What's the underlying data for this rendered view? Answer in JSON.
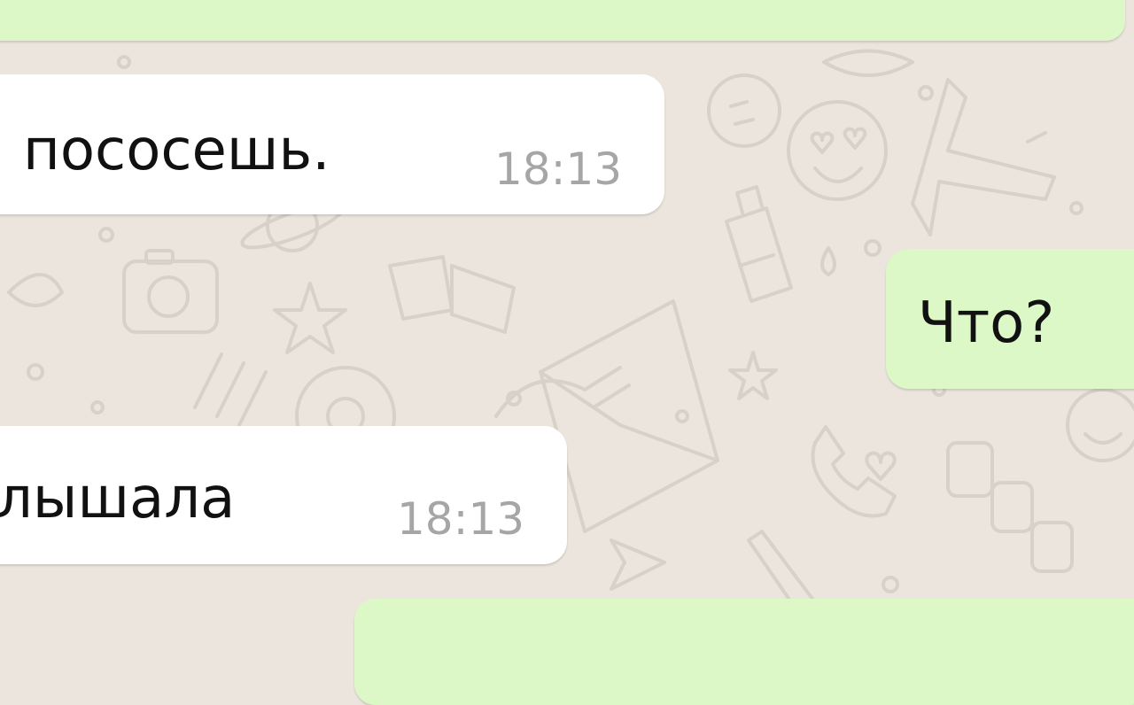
{
  "messages": [
    {
      "direction": "outgoing",
      "text": "",
      "time": ""
    },
    {
      "direction": "incoming",
      "text": "пососешь.",
      "time": "18:13"
    },
    {
      "direction": "outgoing",
      "text": "Что?",
      "time": ""
    },
    {
      "direction": "incoming",
      "text": "лышала",
      "time": "18:13"
    },
    {
      "direction": "outgoing",
      "text": "",
      "time": ""
    }
  ],
  "colors": {
    "background": "#ece5dd",
    "incoming_bubble": "#ffffff",
    "outgoing_bubble": "#dcf8c6",
    "timestamp": "#a6a6a6"
  }
}
